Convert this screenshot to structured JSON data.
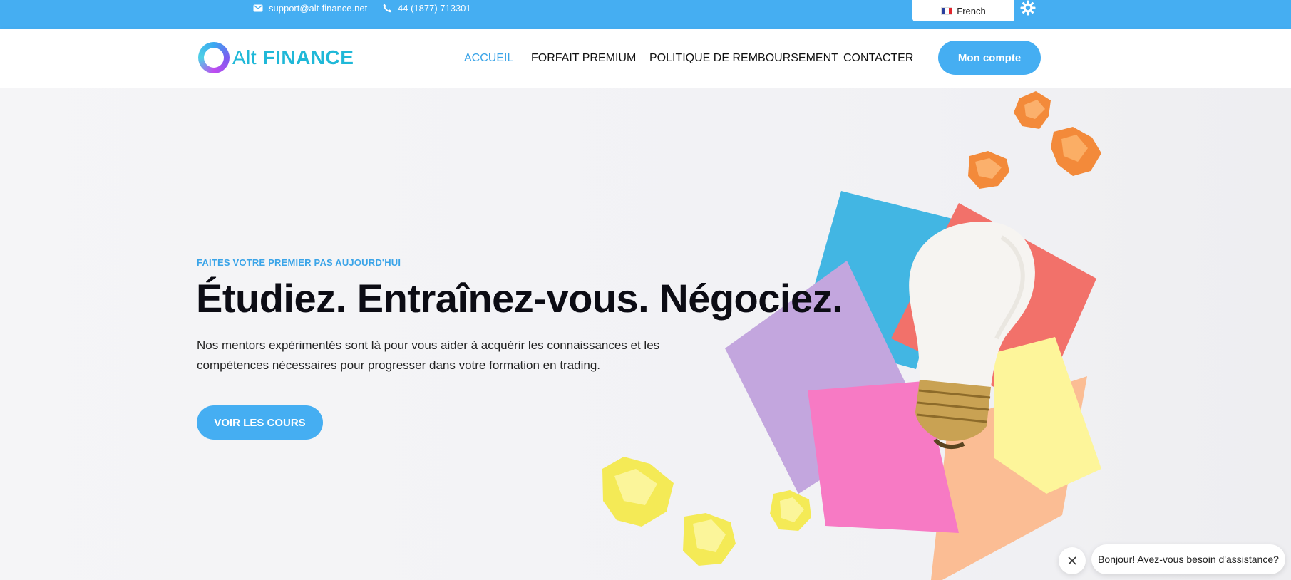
{
  "topbar": {
    "email": "support@alt-finance.net",
    "phone": "44 (1877) 713301",
    "language": "French",
    "icons": {
      "email": "envelope-icon",
      "phone": "phone-icon",
      "settings": "gear-icon",
      "flag": "french-flag-icon"
    }
  },
  "header": {
    "logo": {
      "light": "Alt",
      "bold": "FINANCE"
    },
    "nav": [
      "ACCUEIL",
      "FORFAIT PREMIUM",
      "POLITIQUE DE REMBOURSEMENT",
      "CONTACTER"
    ],
    "active_nav": "ACCUEIL",
    "account_button": "Mon compte"
  },
  "hero": {
    "eyebrow": "FAITES VOTRE PREMIER PAS AUJOURD'HUI",
    "headline": "Étudiez. Entraînez-vous. Négociez.",
    "description": "Nos mentors expérimentés sont là pour vous aider à acquérir les connaissances et les compétences nécessaires pour progresser dans votre formation en trading.",
    "cta": "VOIR LES COURS",
    "image": "light-bulb-on-colorful-sticky-notes-illustration"
  },
  "chat": {
    "message": "Bonjour! Avez-vous besoin d'assistance?",
    "close_icon": "close-icon"
  },
  "colors": {
    "accent": "#45aef2",
    "logo": "#1fb8d8",
    "active_nav": "#3aa4e8",
    "headline": "#0c0c14"
  }
}
